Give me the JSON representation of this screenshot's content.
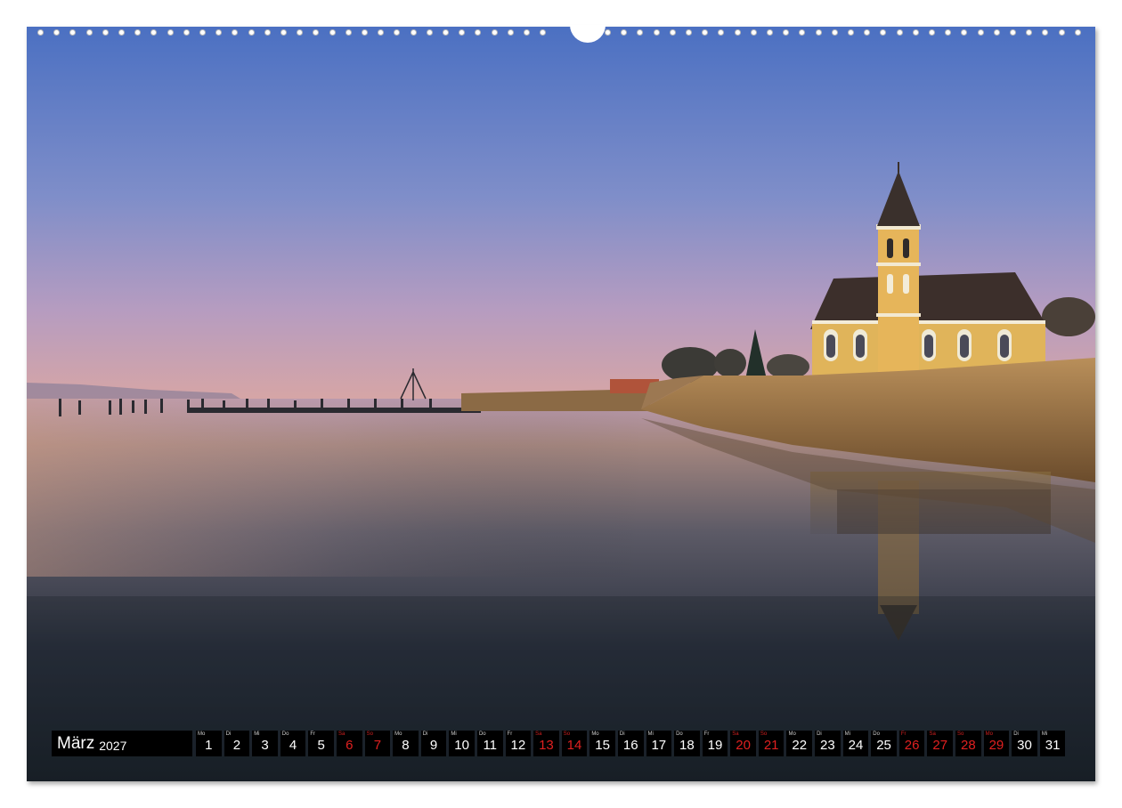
{
  "calendar": {
    "month": "März",
    "year": "2027",
    "days": [
      {
        "wd": "Mo",
        "n": "1",
        "we": false
      },
      {
        "wd": "Di",
        "n": "2",
        "we": false
      },
      {
        "wd": "Mi",
        "n": "3",
        "we": false
      },
      {
        "wd": "Do",
        "n": "4",
        "we": false
      },
      {
        "wd": "Fr",
        "n": "5",
        "we": false
      },
      {
        "wd": "Sa",
        "n": "6",
        "we": true
      },
      {
        "wd": "So",
        "n": "7",
        "we": true
      },
      {
        "wd": "Mo",
        "n": "8",
        "we": false
      },
      {
        "wd": "Di",
        "n": "9",
        "we": false
      },
      {
        "wd": "Mi",
        "n": "10",
        "we": false
      },
      {
        "wd": "Do",
        "n": "11",
        "we": false
      },
      {
        "wd": "Fr",
        "n": "12",
        "we": false
      },
      {
        "wd": "Sa",
        "n": "13",
        "we": true
      },
      {
        "wd": "So",
        "n": "14",
        "we": true
      },
      {
        "wd": "Mo",
        "n": "15",
        "we": false
      },
      {
        "wd": "Di",
        "n": "16",
        "we": false
      },
      {
        "wd": "Mi",
        "n": "17",
        "we": false
      },
      {
        "wd": "Do",
        "n": "18",
        "we": false
      },
      {
        "wd": "Fr",
        "n": "19",
        "we": false
      },
      {
        "wd": "Sa",
        "n": "20",
        "we": true
      },
      {
        "wd": "So",
        "n": "21",
        "we": true
      },
      {
        "wd": "Mo",
        "n": "22",
        "we": false
      },
      {
        "wd": "Di",
        "n": "23",
        "we": false
      },
      {
        "wd": "Mi",
        "n": "24",
        "we": false
      },
      {
        "wd": "Do",
        "n": "25",
        "we": false
      },
      {
        "wd": "Fr",
        "n": "26",
        "we": true
      },
      {
        "wd": "Sa",
        "n": "27",
        "we": true
      },
      {
        "wd": "So",
        "n": "28",
        "we": true
      },
      {
        "wd": "Mo",
        "n": "29",
        "we": true
      },
      {
        "wd": "Di",
        "n": "30",
        "we": false
      },
      {
        "wd": "Mi",
        "n": "31",
        "we": false
      }
    ]
  },
  "colors": {
    "weekend": "#e02020",
    "sky_top": "#4a6fc0",
    "sky_horizon": "#e8a99a"
  }
}
